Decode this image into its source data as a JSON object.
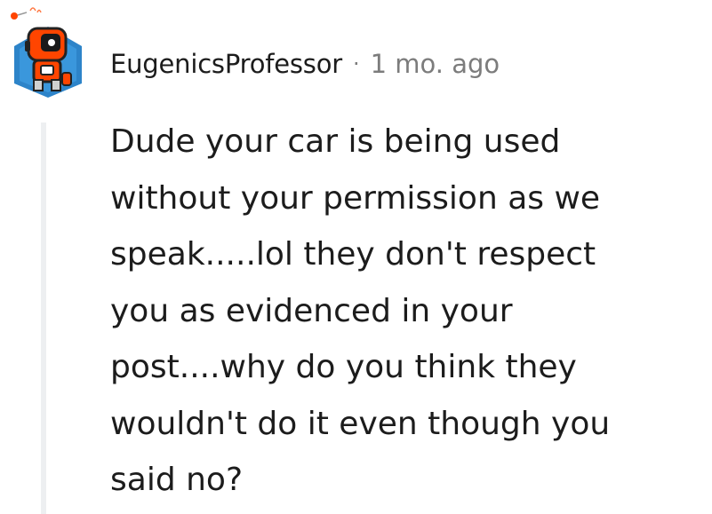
{
  "comment": {
    "author": "EugenicsProfessor",
    "separator": "·",
    "timestamp": "1 mo. ago",
    "body": "Dude your car is being used\nwithout your permission as we\nspeak.....lol they don't respect\nyou as evidenced in your\npost....why do you think they\nwouldn't do it even though you\nsaid no?"
  },
  "colors": {
    "text": "#1c1c1c",
    "meta": "#7c7c7c",
    "thread_line": "#edeff1",
    "avatar_bg": "#2d84c9",
    "avatar_robot": "#ff4500"
  },
  "icons": [
    "reddit-avatar-icon"
  ]
}
